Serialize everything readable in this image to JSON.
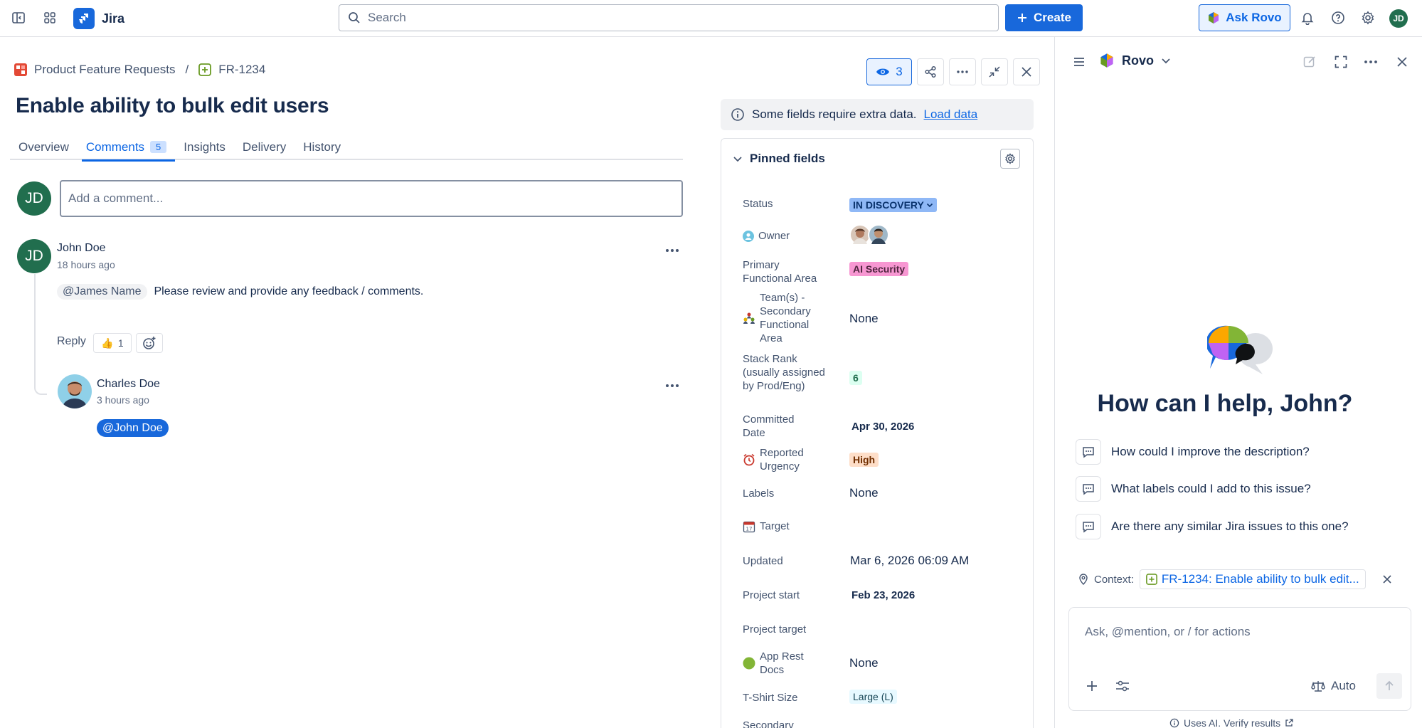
{
  "app": {
    "name": "Jira"
  },
  "topnav": {
    "search_placeholder": "Search",
    "create_label": "Create",
    "ask_rovo_label": "Ask Rovo",
    "user_initials": "JD"
  },
  "colors": {
    "accent": "#1868db",
    "success_avatar": "#216e4e",
    "link": "#0c66e4"
  },
  "breadcrumb": {
    "project": "Product Feature Requests",
    "separator": "/",
    "issue_key": "FR-1234"
  },
  "issue": {
    "title": "Enable ability to bulk edit users",
    "watchers": "3",
    "tabs": [
      {
        "label": "Overview"
      },
      {
        "label": "Comments",
        "count": "5"
      },
      {
        "label": "Insights"
      },
      {
        "label": "Delivery"
      },
      {
        "label": "History"
      }
    ]
  },
  "comments": {
    "current_user_initials": "JD",
    "add_placeholder": "Add a comment...",
    "items": [
      {
        "initials": "JD",
        "author": "John Doe",
        "time": "18 hours ago",
        "mention": "@James Name",
        "text": "Please review and provide any feedback / comments.",
        "reply_label": "Reply",
        "reaction_emoji": "👍",
        "reaction_count": "1"
      },
      {
        "author": "Charles Doe",
        "time": "3 hours ago",
        "mention": "@John Doe"
      }
    ]
  },
  "banner": {
    "text": "Some fields require extra data.",
    "link": "Load data"
  },
  "pinned": {
    "header": "Pinned fields",
    "fields": {
      "status": {
        "label": "Status",
        "value": "IN DISCOVERY"
      },
      "owner": {
        "label": "Owner"
      },
      "primary_area": {
        "label": "Primary Functional Area",
        "value": "AI Security"
      },
      "teams": {
        "label": "Team(s) - Secondary Functional Area",
        "value": "None"
      },
      "stack_rank": {
        "label": "Stack Rank (usually assigned by Prod/Eng)",
        "value": "6"
      },
      "committed": {
        "label": "Committed Date",
        "value": "Apr 30, 2026"
      },
      "urgency": {
        "label": "Reported Urgency",
        "value": "High"
      },
      "labels": {
        "label": "Labels",
        "value": "None"
      },
      "target": {
        "label": "Target"
      },
      "updated": {
        "label": "Updated",
        "value": "Mar 6, 2026 06:09 AM"
      },
      "project_start": {
        "label": "Project start",
        "value": "Feb 23, 2026"
      },
      "project_target": {
        "label": "Project target"
      },
      "app_rest": {
        "label": "App Rest Docs",
        "value": "None"
      },
      "tshirt": {
        "label": "T-Shirt Size",
        "value": "Large (L)"
      },
      "secondary": {
        "label": "Secondary"
      }
    }
  },
  "rovo": {
    "name": "Rovo",
    "greeting": "How can I help,",
    "greeting_name": "John?",
    "suggestions": [
      "How could I improve the description?",
      "What labels could I add to this issue?",
      "Are there any similar Jira issues to this one?"
    ],
    "context_label": "Context:",
    "context_value": "FR-1234: Enable ability to bulk edit...",
    "input_placeholder": "Ask, @mention, or / for actions",
    "mode_label": "Auto",
    "footer": "Uses AI. Verify results"
  }
}
